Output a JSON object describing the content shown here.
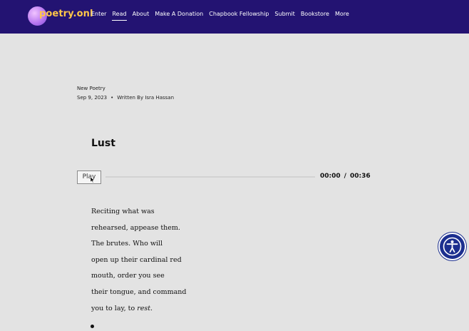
{
  "header": {
    "logo_text": "poetry.onl",
    "nav": [
      "Enter",
      "Read",
      "About",
      "Make A Donation",
      "Chapbook Fellowship",
      "Submit",
      "Bookstore",
      "More"
    ],
    "active_nav": "Read"
  },
  "post": {
    "category": "New Poetry",
    "date": "Sep 9, 2023",
    "separator": "•",
    "author": "Written By Isra Hassan",
    "title": "Lust"
  },
  "player": {
    "play_label": "Play",
    "current_time": "00:00",
    "time_separator": "/",
    "duration": "00:36",
    "progress": 0
  },
  "poem": {
    "lines": [
      "Reciting what was",
      "rehearsed, appease them.",
      "The brutes. Who will",
      "open up their cardinal red",
      "mouth, order you see",
      "their tongue, and command",
      "you to lay, to"
    ],
    "last_word_italic": "rest."
  },
  "accessibility": {
    "icon": "accessibility-icon"
  },
  "colors": {
    "nav_bg": "#231372",
    "page_bg": "#e3e3e3",
    "logo_text": "#ffc648"
  }
}
